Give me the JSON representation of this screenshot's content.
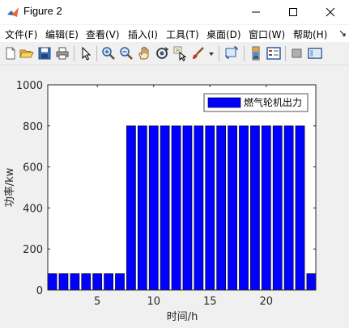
{
  "window": {
    "title": "Figure 2",
    "controls": [
      "—",
      "☐",
      "✕"
    ]
  },
  "menu": [
    {
      "label": "文件(F)"
    },
    {
      "label": "编辑(E)"
    },
    {
      "label": "查看(V)"
    },
    {
      "label": "插入(I)"
    },
    {
      "label": "工具(T)"
    },
    {
      "label": "桌面(D)"
    },
    {
      "label": "窗口(W)"
    },
    {
      "label": "帮助(H)"
    }
  ],
  "menu_overflow": "↘",
  "toolbar": {
    "icons": [
      "new-figure-icon",
      "open-file-icon",
      "save-icon",
      "print-icon",
      "pointer-icon",
      "zoom-in-icon",
      "zoom-out-icon",
      "pan-icon",
      "rotate-3d-icon",
      "data-cursor-icon",
      "brush-icon",
      "dropdown-arrow-icon",
      "link-plot-icon",
      "colorbar-icon",
      "legend-icon",
      "hide-plot-tools-icon",
      "show-plot-tools-icon"
    ]
  },
  "chart_data": {
    "type": "bar",
    "x": [
      1,
      2,
      3,
      4,
      5,
      6,
      7,
      8,
      9,
      10,
      11,
      12,
      13,
      14,
      15,
      16,
      17,
      18,
      19,
      20,
      21,
      22,
      23,
      24
    ],
    "series": [
      {
        "name": "燃气轮机出力",
        "values": [
          80,
          80,
          80,
          80,
          80,
          80,
          80,
          800,
          800,
          800,
          800,
          800,
          800,
          800,
          800,
          800,
          800,
          800,
          800,
          800,
          800,
          800,
          800,
          80
        ]
      }
    ],
    "xlabel": "时间/h",
    "ylabel": "功率/kw",
    "xlim": [
      0.6,
      24.4
    ],
    "ylim": [
      0,
      1000
    ],
    "xticks": [
      5,
      10,
      15,
      20
    ],
    "yticks": [
      0,
      200,
      400,
      600,
      800,
      1000
    ],
    "legend_position": "top-right",
    "grid": false,
    "bar_color": "#0000ff"
  }
}
